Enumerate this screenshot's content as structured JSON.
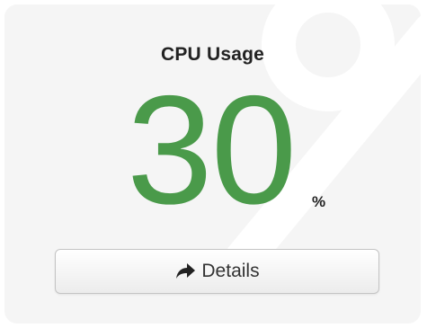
{
  "widget": {
    "title": "CPU Usage",
    "value": "30",
    "unit": "%",
    "value_color": "#4a9a4a",
    "background_icon": "percent-watermark-icon"
  },
  "button": {
    "label": "Details",
    "icon": "share-arrow-icon"
  }
}
